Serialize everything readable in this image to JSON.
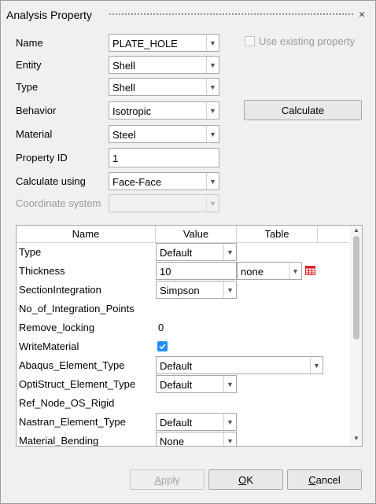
{
  "window": {
    "title": "Analysis Property",
    "close_glyph": "×"
  },
  "form": {
    "name": {
      "label": "Name",
      "value": "PLATE_HOLE"
    },
    "entity": {
      "label": "Entity",
      "value": "Shell"
    },
    "type": {
      "label": "Type",
      "value": "Shell"
    },
    "behavior": {
      "label": "Behavior",
      "value": "Isotropic"
    },
    "material": {
      "label": "Material",
      "value": "Steel"
    },
    "property_id": {
      "label": "Property ID",
      "value": "1"
    },
    "calculate_using": {
      "label": "Calculate using",
      "value": "Face-Face"
    },
    "coordinate_system": {
      "label": "Coordinate system",
      "value": ""
    },
    "use_existing": {
      "label": "Use existing property",
      "checked": false,
      "enabled": false
    },
    "calculate_button": "Calculate"
  },
  "grid": {
    "headers": [
      "Name",
      "Value",
      "Table"
    ],
    "rows": [
      {
        "name": "Type",
        "value": "Default",
        "kind": "combo"
      },
      {
        "name": "Thickness",
        "value": "10",
        "kind": "edit",
        "table": "none"
      },
      {
        "name": "SectionIntegration",
        "value": "Simpson",
        "kind": "combo"
      },
      {
        "name": "No_of_Integration_Points",
        "value": "",
        "kind": "none"
      },
      {
        "name": "Remove_locking",
        "value": "0",
        "kind": "text"
      },
      {
        "name": "WriteMaterial",
        "value": "",
        "kind": "check",
        "checked": true
      },
      {
        "name": "Abaqus_Element_Type",
        "value": "Default",
        "kind": "combo-wide"
      },
      {
        "name": "OptiStruct_Element_Type",
        "value": "Default",
        "kind": "combo"
      },
      {
        "name": "Ref_Node_OS_Rigid",
        "value": "",
        "kind": "none"
      },
      {
        "name": "Nastran_Element_Type",
        "value": "Default",
        "kind": "combo"
      },
      {
        "name": "Material_Bending",
        "value": "None",
        "kind": "combo"
      }
    ]
  },
  "buttons": {
    "apply": {
      "mnemonic": "A",
      "rest": "pply",
      "enabled": false
    },
    "ok": {
      "mnemonic": "O",
      "rest": "K"
    },
    "cancel": {
      "mnemonic": "C",
      "rest": "ancel"
    }
  },
  "colors": {
    "accent": "#1e90ff",
    "table_icon": "#d9222a"
  },
  "icons": {
    "dropdown": "chevron-down-icon",
    "close": "close-icon",
    "table": "table-icon",
    "check": "check-icon"
  }
}
